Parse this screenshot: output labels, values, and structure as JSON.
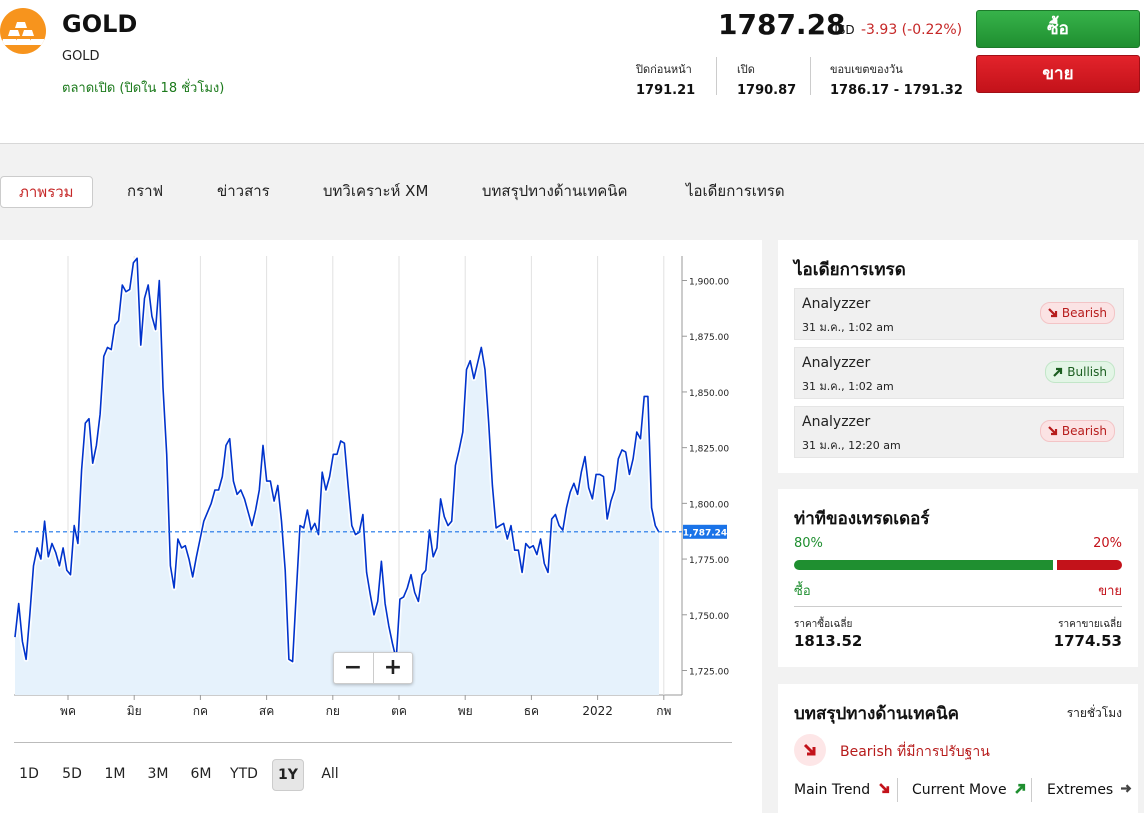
{
  "instrument": {
    "symbol": "GOLD",
    "subtitle": "GOLD",
    "market_status": "ตลาดเปิด (ปิดใน 18 ชั่วโมง)",
    "price": "1787.28",
    "currency": "USD",
    "change": "-3.93 (-0.22%)"
  },
  "stats": [
    {
      "label": "ปิดก่อนหน้า",
      "value": "1791.21"
    },
    {
      "label": "เปิด",
      "value": "1790.87"
    },
    {
      "label": "ขอบเขตของวัน",
      "value": "1786.17 - 1791.32"
    }
  ],
  "actions": {
    "buy": "ซื้อ",
    "sell": "ขาย"
  },
  "tabs": [
    "ภาพรวม",
    "กราฟ",
    "ข่าวสาร",
    "บทวิเคราะห์ XM",
    "บทสรุปทางด้านเทคนิค",
    "ไอเดียการเทรด"
  ],
  "ranges": [
    "1D",
    "5D",
    "1M",
    "3M",
    "6M",
    "YTD",
    "1Y",
    "All"
  ],
  "active_range": "1Y",
  "zoom": {
    "minus": "−",
    "plus": "+"
  },
  "colors": {
    "line": "#0033cc",
    "fill": "#e6f2fc",
    "current": "#1a73e8",
    "buy": "#1f8f30",
    "sell": "#c3121a"
  },
  "chart_data": {
    "type": "area",
    "x_labels": [
      "พค",
      "มิย",
      "กค",
      "สค",
      "กย",
      "ตค",
      "พย",
      "ธค",
      "2022",
      "กพ"
    ],
    "y_ticks": [
      "1,725.00",
      "1,750.00",
      "1,775.00",
      "1,800.00",
      "1,825.00",
      "1,850.00",
      "1,875.00",
      "1,900.00"
    ],
    "ylim": [
      1714,
      1911
    ],
    "current_value": 1787.24,
    "current_label": "1,787.24",
    "grid": true,
    "series": [
      {
        "values": [
          1740,
          1755,
          1738,
          1730,
          1750,
          1772,
          1780,
          1775,
          1792,
          1776,
          1782,
          1778,
          1772,
          1780,
          1770,
          1768,
          1790,
          1782,
          1815,
          1836,
          1838,
          1818,
          1826,
          1840,
          1866,
          1870,
          1869,
          1880,
          1882,
          1898,
          1895,
          1896,
          1908,
          1910,
          1871,
          1892,
          1898,
          1884,
          1878,
          1900,
          1852,
          1822,
          1772,
          1762,
          1784,
          1780,
          1781,
          1775,
          1767,
          1776,
          1784,
          1792,
          1796,
          1800,
          1806,
          1806,
          1812,
          1826,
          1829,
          1810,
          1804,
          1806,
          1802,
          1796,
          1790,
          1797,
          1806,
          1826,
          1810,
          1810,
          1801,
          1808,
          1792,
          1770,
          1730,
          1729,
          1760,
          1790,
          1789,
          1797,
          1788,
          1791,
          1786,
          1814,
          1806,
          1812,
          1822,
          1822,
          1828,
          1827,
          1808,
          1790,
          1786,
          1787,
          1795,
          1769,
          1759,
          1750,
          1756,
          1774,
          1755,
          1745,
          1737,
          1730,
          1757,
          1758,
          1762,
          1768,
          1760,
          1756,
          1768,
          1770,
          1788,
          1776,
          1780,
          1802,
          1794,
          1790,
          1792,
          1817,
          1824,
          1832,
          1860,
          1864,
          1856,
          1863,
          1870,
          1860,
          1836,
          1808,
          1789,
          1790,
          1791,
          1784,
          1790,
          1779,
          1779,
          1769,
          1782,
          1780,
          1781,
          1777,
          1784,
          1773,
          1769,
          1793,
          1795,
          1790,
          1788,
          1798,
          1805,
          1809,
          1804,
          1814,
          1821,
          1807,
          1802,
          1813,
          1813,
          1812,
          1793,
          1801,
          1806,
          1820,
          1824,
          1823,
          1813,
          1820,
          1832,
          1829,
          1848,
          1848,
          1798,
          1790,
          1787
        ]
      }
    ]
  },
  "trade_ideas": {
    "title": "ไอเดียการเทรด",
    "items": [
      {
        "author": "Analyzzer",
        "time": "31 ม.ค., 1:02 am",
        "signal": "Bearish"
      },
      {
        "author": "Analyzzer",
        "time": "31 ม.ค., 1:02 am",
        "signal": "Bullish"
      },
      {
        "author": "Analyzzer",
        "time": "31 ม.ค., 12:20 am",
        "signal": "Bearish"
      }
    ]
  },
  "sentiment": {
    "title": "ท่าทีของเทรดเดอร์",
    "buy_pct_label": "80%",
    "sell_pct_label": "20%",
    "buy_fraction": 0.8,
    "buy_label": "ซื้อ",
    "sell_label": "ขาย",
    "avg_buy_label": "ราคาซื้อเฉลี่ย",
    "avg_buy": "1813.52",
    "avg_sell_label": "ราคาขายเฉลี่ย",
    "avg_sell": "1774.53"
  },
  "technical": {
    "title": "บทสรุปทางด้านเทคนิค",
    "timeframe": "รายชั่วโมง",
    "summary": "Bearish ที่มีการปรับฐาน",
    "metrics": [
      "Main Trend",
      "Current Move",
      "Extremes"
    ]
  }
}
